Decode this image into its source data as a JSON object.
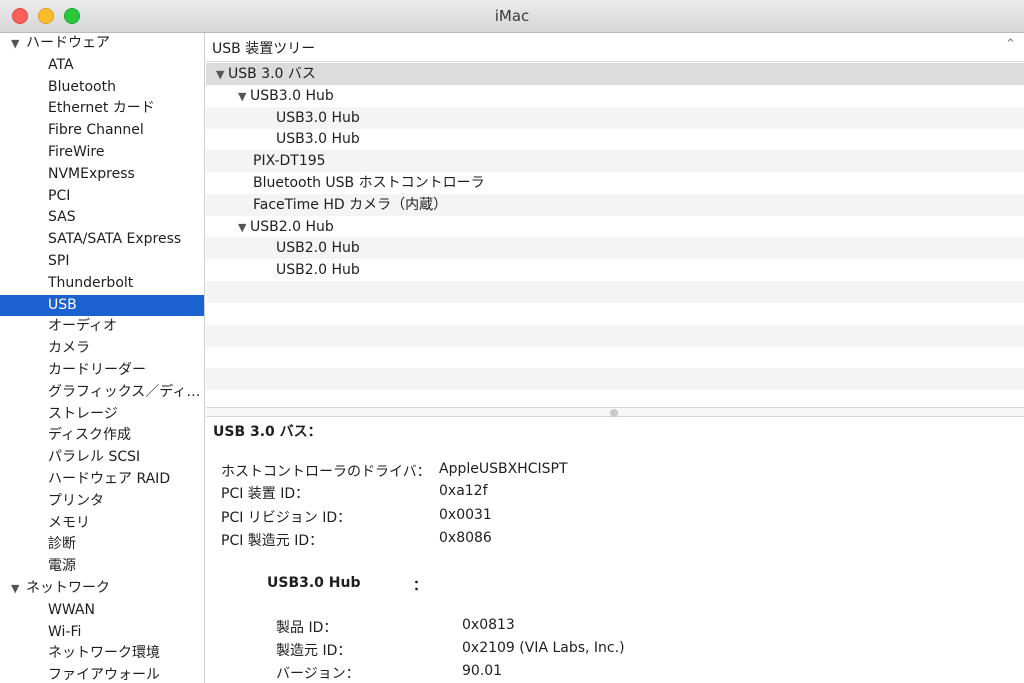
{
  "window": {
    "title": "iMac"
  },
  "sidebar": {
    "groups": [
      {
        "label": "ハードウェア"
      },
      {
        "label": "ネットワーク"
      }
    ],
    "hardware_items": [
      "ATA",
      "Bluetooth",
      "Ethernet カード",
      "Fibre Channel",
      "FireWire",
      "NVMExpress",
      "PCI",
      "SAS",
      "SATA/SATA Express",
      "SPI",
      "Thunderbolt",
      "USB",
      "オーディオ",
      "カメラ",
      "カードリーダー",
      "グラフィックス／ディ…",
      "ストレージ",
      "ディスク作成",
      "パラレル SCSI",
      "ハードウェア RAID",
      "プリンタ",
      "メモリ",
      "診断",
      "電源"
    ],
    "network_items": [
      "WWAN",
      "Wi-Fi",
      "ネットワーク環境",
      "ファイアウォール"
    ],
    "selected": "USB"
  },
  "tree": {
    "header": "USB 装置ツリー",
    "rows": [
      {
        "label": "USB 3.0 バス",
        "level": 0,
        "expanded": true
      },
      {
        "label": "USB3.0 Hub",
        "level": 1,
        "expanded": true
      },
      {
        "label": "USB3.0 Hub",
        "level": 2
      },
      {
        "label": "USB3.0 Hub",
        "level": 2
      },
      {
        "label": "PIX-DT195",
        "level": 1
      },
      {
        "label": "Bluetooth USB ホストコントローラ",
        "level": 1
      },
      {
        "label": "FaceTime HD カメラ（内蔵）",
        "level": 1
      },
      {
        "label": "USB2.0 Hub",
        "level": 1,
        "expanded": true
      },
      {
        "label": "USB2.0 Hub",
        "level": 2
      },
      {
        "label": "USB2.0 Hub",
        "level": 2
      }
    ]
  },
  "detail": {
    "title": "USB 3.0 バス：",
    "properties": [
      {
        "key": "ホストコントローラのドライバ：",
        "value": "AppleUSBXHCISPT"
      },
      {
        "key": "PCI 装置 ID：",
        "value": "0xa12f"
      },
      {
        "key": "PCI リビジョン ID：",
        "value": "0x0031"
      },
      {
        "key": "PCI 製造元 ID：",
        "value": "0x8086"
      }
    ],
    "sub": {
      "title": "USB3.0 Hub",
      "colon": "：",
      "properties": [
        {
          "key": "製品 ID：",
          "value": "0x0813"
        },
        {
          "key": "製造元 ID：",
          "value": "0x2109  (VIA Labs, Inc.)"
        },
        {
          "key": "バージョン：",
          "value": "90.01"
        }
      ]
    }
  }
}
